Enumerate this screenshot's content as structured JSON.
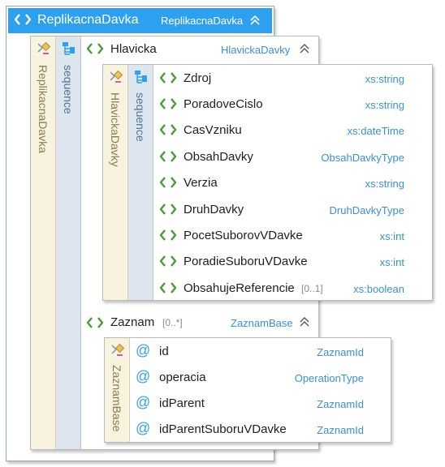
{
  "root": {
    "name": "ReplikacnaDavka",
    "type": "ReplikacnaDavka",
    "vertical_label": "ReplikacnaDavka",
    "compositor": "sequence"
  },
  "hlavicka": {
    "name": "Hlavicka",
    "type": "HlavickaDavky",
    "vertical_label": "HlavickaDavky",
    "compositor": "sequence",
    "elements": [
      {
        "name": "Zdroj",
        "type": "xs:string",
        "card": ""
      },
      {
        "name": "PoradoveCislo",
        "type": "xs:string",
        "card": ""
      },
      {
        "name": "CasVzniku",
        "type": "xs:dateTime",
        "card": ""
      },
      {
        "name": "ObsahDavky",
        "type": "ObsahDavkyType",
        "card": ""
      },
      {
        "name": "Verzia",
        "type": "xs:string",
        "card": ""
      },
      {
        "name": "DruhDavky",
        "type": "DruhDavkyType",
        "card": ""
      },
      {
        "name": "PocetSuborovVDavke",
        "type": "xs:int",
        "card": ""
      },
      {
        "name": "PoradieSuboruVDavke",
        "type": "xs:int",
        "card": ""
      },
      {
        "name": "ObsahujeReferencie",
        "type": "xs:boolean",
        "card": "[0..1]"
      }
    ]
  },
  "zaznam": {
    "name": "Zaznam",
    "card": "[0..*]",
    "type": "ZaznamBase",
    "vertical_label": "ZaznamBase",
    "attributes": [
      {
        "name": "id",
        "type": "ZaznamId"
      },
      {
        "name": "operacia",
        "type": "OperationType"
      },
      {
        "name": "idParent",
        "type": "ZaznamId"
      },
      {
        "name": "idParentSuboruVDavke",
        "type": "ZaznamId"
      }
    ]
  },
  "colors": {
    "accent": "#2ea0f0",
    "element_icon": "#4a9a35",
    "type_text": "#3b8fd6",
    "strip_yellow": "#f8f3de",
    "strip_blue": "#dde5ee",
    "attribute_icon": "#2ea0f0"
  }
}
